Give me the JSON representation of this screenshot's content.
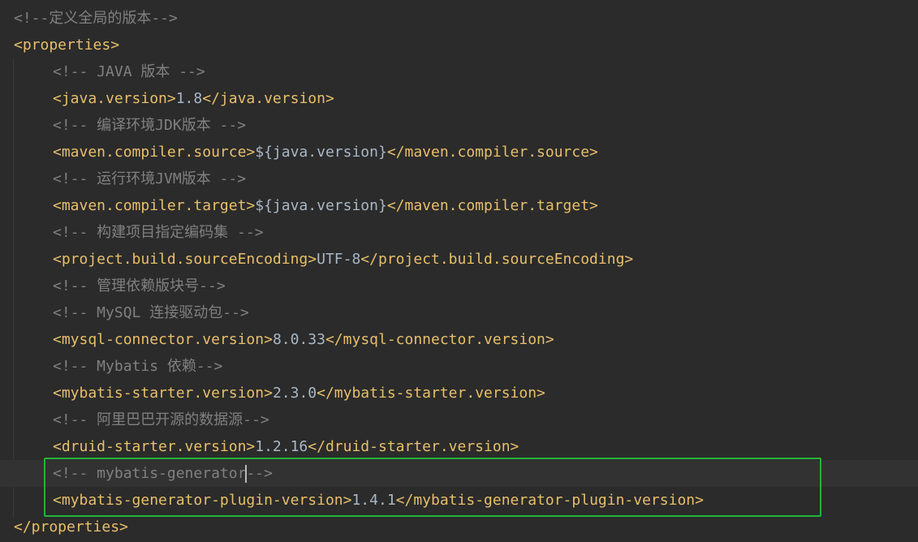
{
  "colors": {
    "background": "#2b2b2b",
    "tag": "#e8bf6a",
    "comment": "#808080",
    "text": "#a9b7c6",
    "highlight_box": "#22b53a"
  },
  "lines": [
    {
      "comment": "<!--定义全局的版本-->"
    },
    {
      "open": "<properties>"
    },
    {
      "comment": "<!-- JAVA 版本 -->"
    },
    {
      "open": "<java.version>",
      "value": "1.8",
      "close": "</java.version>"
    },
    {
      "comment": "<!-- 编译环境JDK版本 -->"
    },
    {
      "open": "<maven.compiler.source>",
      "value": "${java.version}",
      "close": "</maven.compiler.source>"
    },
    {
      "comment": "<!-- 运行环境JVM版本 -->"
    },
    {
      "open": "<maven.compiler.target>",
      "value": "${java.version}",
      "close": "</maven.compiler.target>"
    },
    {
      "comment": "<!-- 构建项目指定编码集 -->"
    },
    {
      "open": "<project.build.sourceEncoding>",
      "value": "UTF-8",
      "close": "</project.build.sourceEncoding>"
    },
    {
      "comment": "<!-- 管理依赖版块号-->"
    },
    {
      "comment": "<!-- MySQL 连接驱动包-->"
    },
    {
      "open": "<mysql-connector.version>",
      "value": "8.0.33",
      "close": "</mysql-connector.version>"
    },
    {
      "comment": "<!-- Mybatis 依赖-->"
    },
    {
      "open": "<mybatis-starter.version>",
      "value": "2.3.0",
      "close": "</mybatis-starter.version>"
    },
    {
      "comment": "<!-- 阿里巴巴开源的数据源-->"
    },
    {
      "open": "<druid-starter.version>",
      "value": "1.2.16",
      "close": "</druid-starter.version>"
    },
    {
      "comment_before_caret": "<!-- mybatis-generator",
      "comment_after_caret": "-->"
    },
    {
      "open": "<mybatis-generator-plugin-version>",
      "value": "1.4.1",
      "close": "</mybatis-generator-plugin-version>"
    },
    {
      "close": "</properties>"
    }
  ]
}
